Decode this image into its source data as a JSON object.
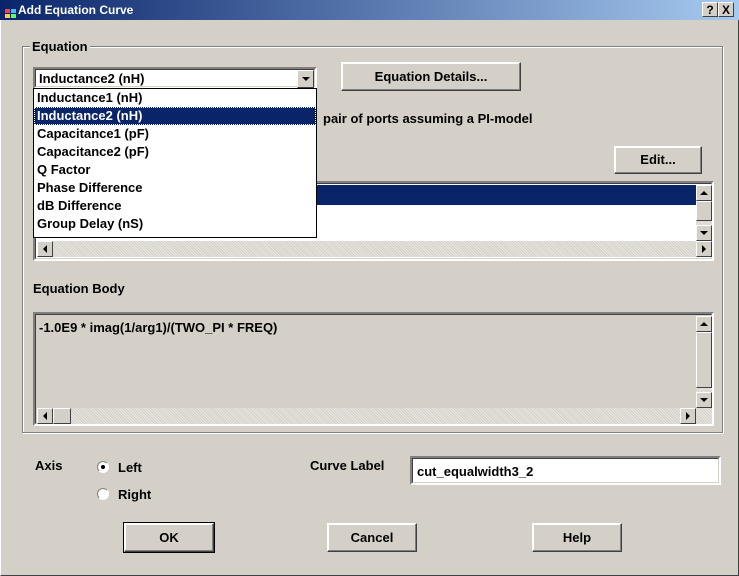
{
  "window": {
    "title": "Add Equation Curve",
    "help_glyph": "?",
    "close_glyph": "X"
  },
  "equation": {
    "group_label": "Equation",
    "selected": "Inductance2 (nH)",
    "details_button": "Equation Details...",
    "description_partial": "pair of ports assuming a PI-model",
    "options": [
      "Inductance1 (nH)",
      "Inductance2 (nH)",
      "Capacitance1 (pF)",
      "Capacitance2 (pF)",
      "Q Factor",
      "Phase Difference",
      "dB Difference",
      "Group Delay (nS)"
    ],
    "edit_button": "Edit..."
  },
  "equation_body": {
    "label": "Equation Body",
    "text": "-1.0E9 * imag(1/arg1)/(TWO_PI * FREQ)"
  },
  "axis": {
    "label": "Axis",
    "options": [
      "Left",
      "Right"
    ],
    "selected": "Left"
  },
  "curve_label": {
    "label": "Curve Label",
    "value": "cut_equalwidth3_2"
  },
  "buttons": {
    "ok": "OK",
    "cancel": "Cancel",
    "help": "Help"
  }
}
